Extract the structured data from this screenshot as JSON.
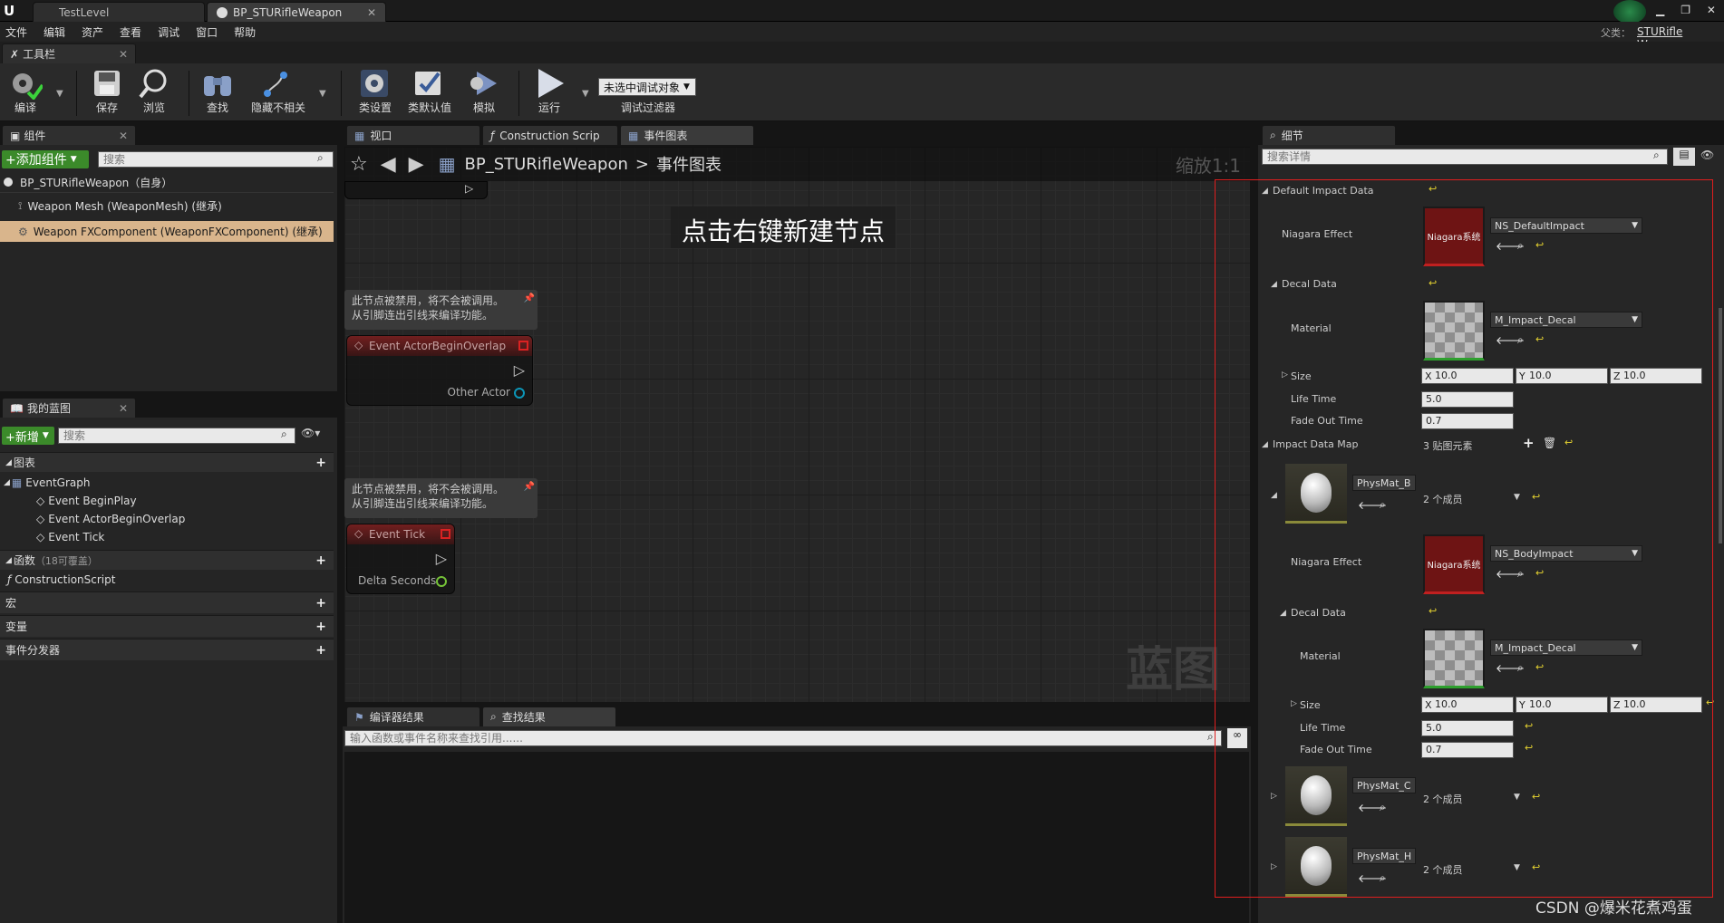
{
  "doc_tabs": [
    {
      "label": "TestLevel"
    },
    {
      "label": "BP_STURifleWeapon"
    }
  ],
  "menu": [
    "文件",
    "编辑",
    "资产",
    "查看",
    "调试",
    "窗口",
    "帮助"
  ],
  "parent_class": {
    "label": "父类：",
    "value": "STURifle Weapon"
  },
  "toolbar_tab": "工具栏",
  "toolbar": {
    "compile": "编译",
    "save": "保存",
    "browse": "浏览",
    "find": "查找",
    "hide": "隐藏不相关",
    "class_settings": "类设置",
    "class_defaults": "类默认值",
    "simulate": "模拟",
    "run": "运行",
    "debug_select": "未选中调试对象",
    "debug_filter": "调试过滤器"
  },
  "components": {
    "tab": "组件",
    "add_button": "+添加组件",
    "search_placeholder": "搜索",
    "items": [
      {
        "label": "BP_STURifleWeapon（自身）"
      },
      {
        "label": "Weapon Mesh (WeaponMesh) (继承)"
      },
      {
        "label": "Weapon FXComponent (WeaponFXComponent) (继承)"
      }
    ]
  },
  "my_blueprint": {
    "tab": "我的蓝图",
    "new_button": "+新增",
    "search_placeholder": "搜索",
    "graphs_label": "图表",
    "event_graph": "EventGraph",
    "events": [
      "Event BeginPlay",
      "Event ActorBeginOverlap",
      "Event Tick"
    ],
    "functions_label": "函数",
    "functions_count": "（18可覆盖）",
    "construction": "ConstructionScript",
    "macros": "宏",
    "variables": "变量",
    "dispatchers": "事件分发器"
  },
  "graph_tabs": [
    {
      "label": "视口"
    },
    {
      "label": "Construction Scrip"
    },
    {
      "label": "事件图表"
    }
  ],
  "graph": {
    "breadcrumb_root": "BP_STURifleWeapon",
    "breadcrumb_sep": ">",
    "breadcrumb_leaf": "事件图表",
    "zoom": "缩放1:1",
    "hint": "点击右键新建节点",
    "watermark": "蓝图",
    "comment1_line1": "此节点被禁用，将不会被调用。",
    "comment1_line2": "从引脚连出引线来编译功能。",
    "node1_title": "Event ActorBeginOverlap",
    "node1_pin": "Other Actor",
    "comment2_line1": "此节点被禁用，将不会被调用。",
    "comment2_line2": "从引脚连出引线来编译功能。",
    "node2_title": "Event Tick",
    "node2_pin": "Delta Seconds"
  },
  "bottom": {
    "tab_compiler": "编译器结果",
    "tab_find": "查找结果",
    "search_placeholder": "输入函数或事件名称来查找引用......"
  },
  "details": {
    "tab": "细节",
    "search_placeholder": "搜索详情",
    "default_impact": "Default Impact Data",
    "niagara_effect": "Niagara Effect",
    "niagara_value": "NS_DefaultImpact",
    "niagara_thumb": "Niagara系统",
    "decal_data": "Decal Data",
    "material": "Material",
    "material_value": "M_Impact_Decal",
    "size": "Size",
    "x": "X",
    "y": "Y",
    "z": "Z",
    "size_x": "10.0",
    "size_y": "10.0",
    "size_z": "10.0",
    "life_time": "Life Time",
    "life_value": "5.0",
    "fade_out": "Fade Out Time",
    "fade_value": "0.7",
    "impact_map": "Impact Data Map",
    "impact_count": "3 贴图元素",
    "map_items": [
      {
        "key": "PhysMat_B",
        "count": "2 个成员"
      },
      {
        "key": "PhysMat_C",
        "count": "2 个成员"
      },
      {
        "key": "PhysMat_H",
        "count": "2 个成员"
      }
    ],
    "niagara2_value": "NS_BodyImpact",
    "material2_value": "M_Impact_Decal",
    "size2_x": "10.0",
    "size2_y": "10.0",
    "size2_z": "10.0",
    "life2_value": "5.0",
    "fade2_value": "0.7"
  },
  "watermark_text": "CSDN @爆米花煮鸡蛋"
}
